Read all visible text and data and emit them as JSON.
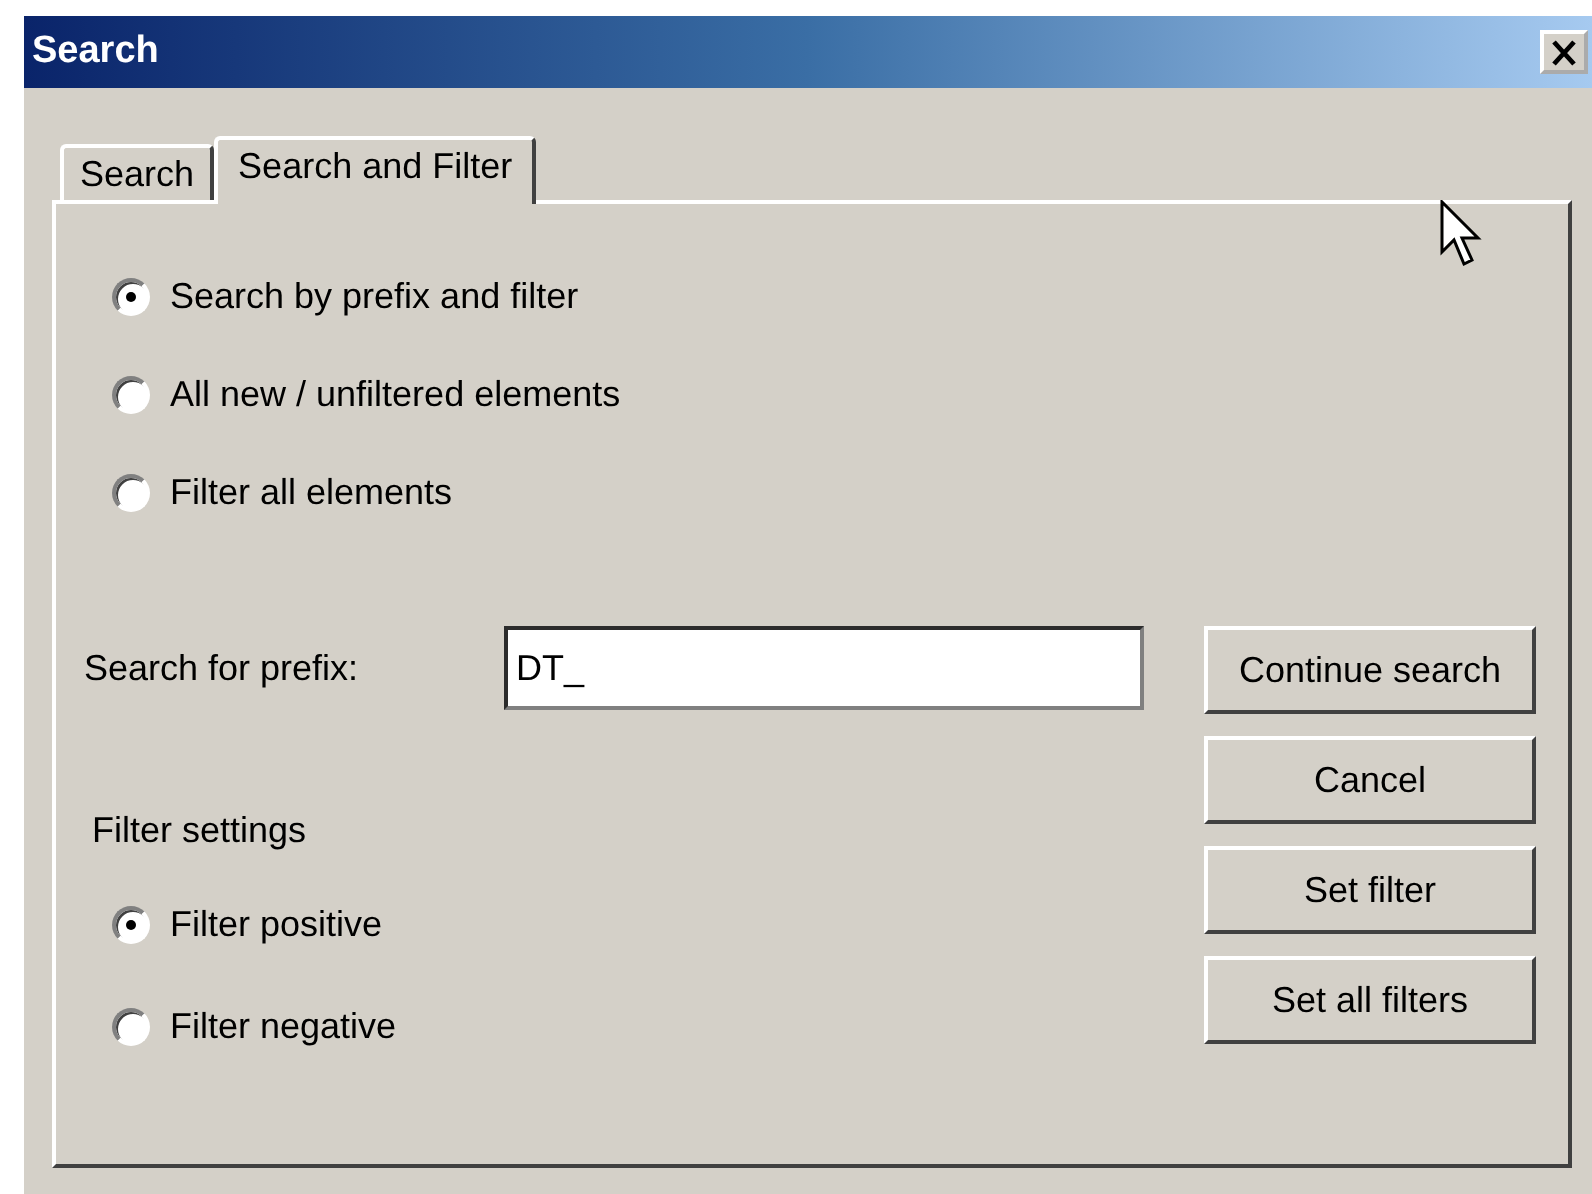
{
  "window": {
    "title": "Search"
  },
  "tabs": [
    {
      "label": "Search",
      "selected": false
    },
    {
      "label": "Search and Filter",
      "selected": true
    }
  ],
  "search_modes": [
    {
      "label": "Search by prefix and filter",
      "selected": true
    },
    {
      "label": "All new / unfiltered elements",
      "selected": false
    },
    {
      "label": "Filter all elements",
      "selected": false
    }
  ],
  "prefix_field": {
    "label": "Search for prefix:",
    "value": "DT_"
  },
  "filter_settings": {
    "title": "Filter settings",
    "options": [
      {
        "label": "Filter positive",
        "selected": true
      },
      {
        "label": "Filter negative",
        "selected": false
      }
    ]
  },
  "buttons": [
    "Continue search",
    "Cancel",
    "Set filter",
    "Set all filters"
  ]
}
